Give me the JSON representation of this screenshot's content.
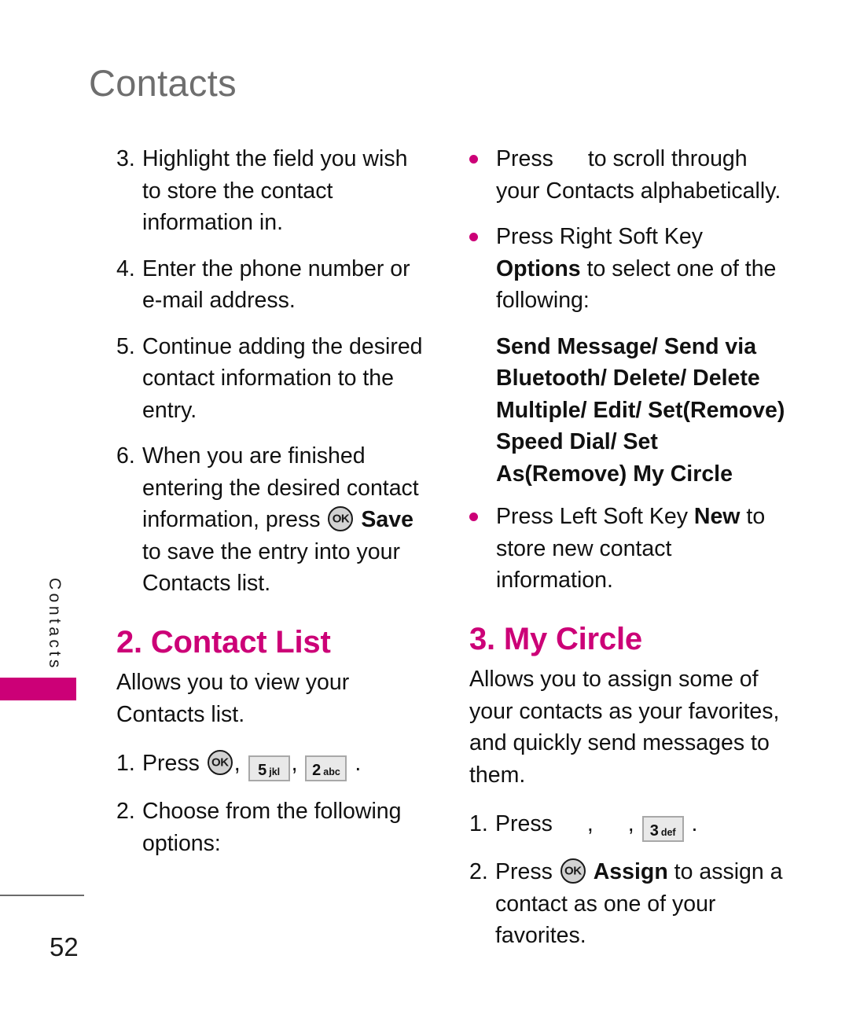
{
  "header": {
    "title": "Contacts"
  },
  "side_tab": {
    "label": "Contacts",
    "bar_color": "#cc0077"
  },
  "colors": {
    "accent_pink": "#cc0077",
    "header_gray": "#6e6e6e",
    "key_fill": "#e9e9e9",
    "ok_fill": "#d2d2d2"
  },
  "footer": {
    "page_number": "52"
  },
  "left_column": {
    "steps": [
      {
        "num": "3.",
        "text": "Highlight the field you wish to store the contact information in."
      },
      {
        "num": "4.",
        "text": "Enter the phone number or e-mail address."
      },
      {
        "num": "5.",
        "text": "Continue adding the desired contact information to the entry."
      }
    ],
    "step6": {
      "num": "6.",
      "text_before": "When you are finished entering the desired contact information, press",
      "ok_key": "OK",
      "bold_label": "Save",
      "text_after": "to save the entry into your Contacts list."
    },
    "section": {
      "heading": "2. Contact List",
      "lead": "Allows you to view your Contacts list.",
      "step1": {
        "num": "1.",
        "press_label": "Press",
        "keys": [
          {
            "type": "ok",
            "label": "OK"
          },
          {
            "type": "num",
            "digit": "5",
            "letters": "jkl"
          },
          {
            "type": "num",
            "digit": "2",
            "letters": "abc"
          }
        ],
        "separator": ",",
        "terminator": "."
      },
      "step2": {
        "num": "2.",
        "text": "Choose from the following options:"
      }
    }
  },
  "right_column": {
    "bullets": [
      {
        "text_before": "Press",
        "has_nav_key_gap": true,
        "text_after": "to scroll through your Contacts alphabetically."
      },
      {
        "text_before": "Press Right Soft Key",
        "bold_label": "Options",
        "text_after": "to select one of the following:"
      }
    ],
    "options_list": "Send Message/ Send via Bluetooth/ Delete/ Delete Multiple/ Edit/ Set(Remove) Speed Dial/ Set As(Remove) My Circle",
    "bullet_new": {
      "text_before": "Press Left Soft Key",
      "bold_label": "New",
      "text_after": "to store new contact information."
    },
    "section": {
      "heading": "3. My Circle",
      "lead": "Allows you to assign some of your contacts as your favorites, and quickly send messages to them.",
      "step1": {
        "num": "1.",
        "press_label": "Press",
        "keys": [
          {
            "type": "gap"
          },
          {
            "type": "gap"
          },
          {
            "type": "num",
            "digit": "3",
            "letters": "def"
          }
        ],
        "separator": ",",
        "terminator": "."
      },
      "step2": {
        "num": "2.",
        "press_label": "Press",
        "ok_key": "OK",
        "bold_label": "Assign",
        "text_after": "to assign a contact as one of your favorites."
      }
    }
  }
}
